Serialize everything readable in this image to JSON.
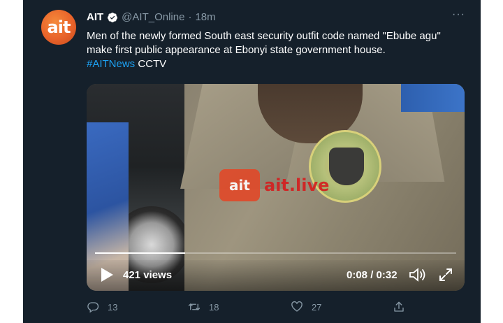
{
  "tweet": {
    "author_name": "AIT",
    "handle": "@AIT_Online",
    "separator": "·",
    "time": "18m",
    "more_label": "···",
    "avatar_text": "ait",
    "text_main": "Men of the newly formed South east security outfit code named \"Ebube agu\" make first public appearance at Ebonyi state government house.",
    "hashtag": "#AITNews",
    "text_tail": "CCTV"
  },
  "video": {
    "watermark_logo": "ait",
    "watermark_text": "ait.live",
    "views": "421 views",
    "timecode": "0:08 / 0:32",
    "progress": 0.25
  },
  "actions": {
    "replies": "13",
    "retweets": "18",
    "likes": "27"
  },
  "colors": {
    "background": "#15202b",
    "text": "#ffffff",
    "muted": "#8899a6",
    "link": "#1da1f2",
    "brand": "#e8632a"
  },
  "icons": [
    "verified-icon",
    "more-icon",
    "play-icon",
    "volume-icon",
    "fullscreen-icon",
    "reply-icon",
    "retweet-icon",
    "like-icon",
    "share-icon"
  ]
}
